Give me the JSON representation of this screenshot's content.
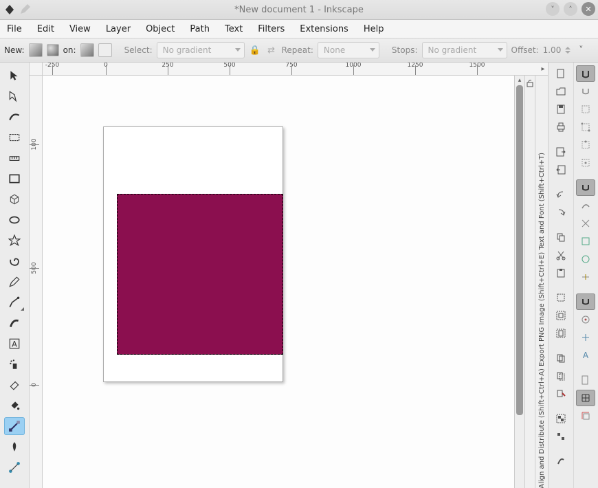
{
  "window": {
    "title": "*New document 1 - Inkscape"
  },
  "menubar": {
    "items": [
      "File",
      "Edit",
      "View",
      "Layer",
      "Object",
      "Path",
      "Text",
      "Filters",
      "Extensions",
      "Help"
    ]
  },
  "toolbar": {
    "new_label": "New:",
    "on_label": "on:",
    "select_label": "Select:",
    "select_combo": "No gradient",
    "repeat_label": "Repeat:",
    "repeat_combo": "None",
    "stops_label": "Stops:",
    "stops_combo": "No gradient",
    "offset_label": "Offset:",
    "offset_value": "1.00"
  },
  "rulers": {
    "h_labels": [
      "-250",
      "0",
      "250",
      "500",
      "750",
      "1000",
      "1250",
      "1500"
    ],
    "v_labels": [
      "100",
      "500",
      "0"
    ]
  },
  "dock": {
    "tabs_text": "Align and Distribute (Shift+Ctrl+A)    Export PNG Image (Shift+Ctrl+E)    Text and Font (Shift+Ctrl+T)"
  },
  "canvas": {
    "shape_fill": "#8b0f4f"
  }
}
